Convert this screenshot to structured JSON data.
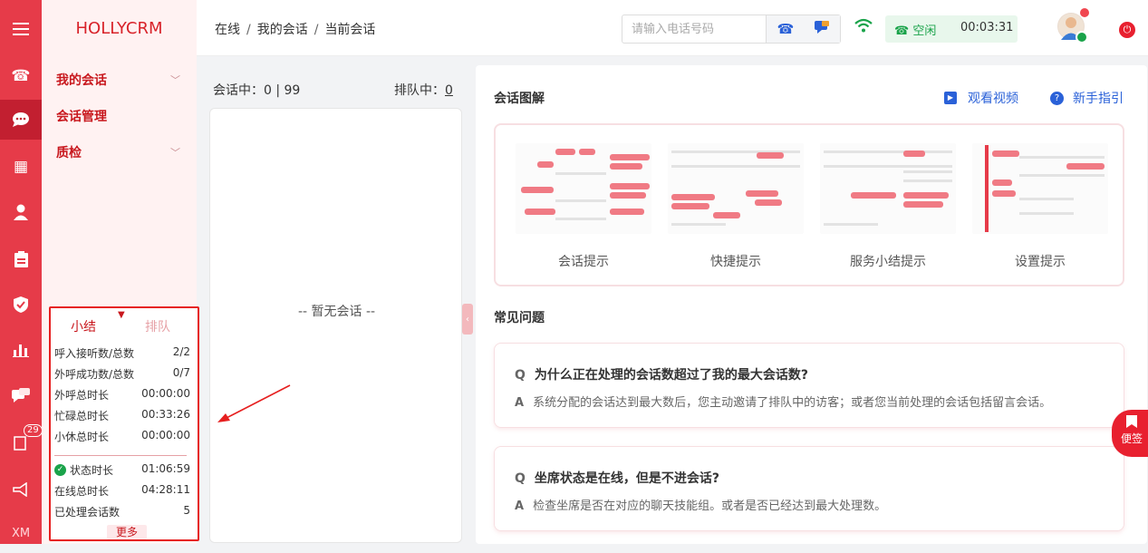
{
  "brand": "HOLLYCRM",
  "breadcrumb": [
    "在线",
    "我的会话",
    "当前会话"
  ],
  "breadcrumb_sep": "/",
  "phone_placeholder": "请输入电话号码",
  "status": {
    "label": "空闲",
    "timer": "00:03:31"
  },
  "rail": {
    "badge": "29",
    "footer": "XM"
  },
  "menu": [
    {
      "label": "我的会话"
    },
    {
      "label": "会话管理"
    },
    {
      "label": "质检"
    }
  ],
  "summary": {
    "tab_active": "小结",
    "tab_inactive": "排队",
    "rows": [
      {
        "label": "呼入接听数/总数",
        "value": "2/2"
      },
      {
        "label": "外呼成功数/总数",
        "value": "0/7"
      },
      {
        "label": "外呼总时长",
        "value": "00:00:00"
      },
      {
        "label": "忙碌总时长",
        "value": "00:33:26"
      },
      {
        "label": "小休总时长",
        "value": "00:00:00"
      }
    ],
    "rows2": [
      {
        "label": "状态时长",
        "value": "01:06:59"
      },
      {
        "label": "在线总时长",
        "value": "04:28:11"
      },
      {
        "label": "已处理会话数",
        "value": "5"
      }
    ],
    "more": "更多"
  },
  "queue": {
    "count_label": "会话中：",
    "count_value": "0 | 99",
    "lineup_label": "排队中：",
    "lineup_value": "0",
    "empty_text": "-- 暂无会话 --"
  },
  "main": {
    "diagram_title": "会话图解",
    "video_link": "观看视频",
    "guide_link": "新手指引",
    "diagram_items": [
      "会话提示",
      "快捷提示",
      "服务小结提示",
      "设置提示"
    ],
    "faq_title": "常见问题",
    "faqs": [
      {
        "q": "为什么正在处理的会话数超过了我的最大会话数?",
        "a": "系统分配的会话达到最大数后，您主动邀请了排队中的访客；或者您当前处理的会话包括留言会话。"
      },
      {
        "q": "坐席状态是在线，但是不进会话?",
        "a": "检查坐席是否在对应的聊天技能组。或者是否已经达到最大处理数。"
      }
    ],
    "q_mark": "Q",
    "a_mark": "A"
  },
  "sticky_label": "便签",
  "colors": {
    "accent": "#e63b49",
    "menu_text": "#c8181e",
    "link": "#2a61d8",
    "status_green": "#1aa34a",
    "highlight_border": "#e61f1f"
  },
  "icons": [
    "menu-icon",
    "phone-icon",
    "chat-icon",
    "grid-icon",
    "user-icon",
    "clipboard-icon",
    "shield-icon",
    "bar-chart-icon",
    "message-icon",
    "book-icon",
    "megaphone-icon",
    "wifi-icon",
    "power-icon"
  ]
}
